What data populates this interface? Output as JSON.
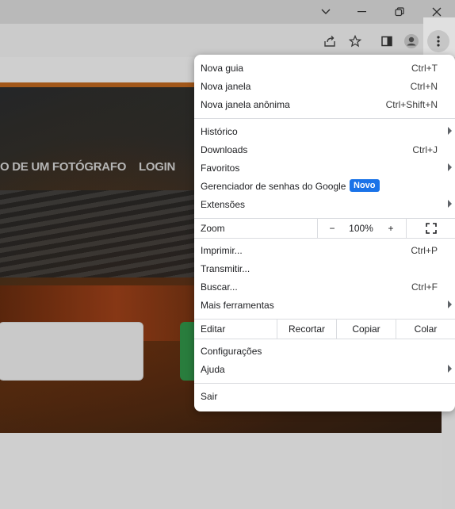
{
  "window": {
    "icons": [
      "chevron-down-icon",
      "minimize-icon",
      "restore-icon",
      "close-icon"
    ]
  },
  "toolbar": {
    "icons": [
      "share-icon",
      "star-icon",
      "side-panel-icon",
      "profile-icon",
      "kebab-menu-icon"
    ]
  },
  "page": {
    "nav_about": "O DE UM FOTÓGRAFO",
    "nav_login": "LOGIN"
  },
  "menu": {
    "new_tab": {
      "label": "Nova guia",
      "shortcut": "Ctrl+T"
    },
    "new_window": {
      "label": "Nova janela",
      "shortcut": "Ctrl+N"
    },
    "incognito": {
      "label": "Nova janela anônima",
      "shortcut": "Ctrl+Shift+N"
    },
    "history": {
      "label": "Histórico"
    },
    "downloads": {
      "label": "Downloads",
      "shortcut": "Ctrl+J"
    },
    "bookmarks": {
      "label": "Favoritos"
    },
    "passwords": {
      "label": "Gerenciador de senhas do Google",
      "badge": "Novo"
    },
    "extensions": {
      "label": "Extensões"
    },
    "zoom": {
      "label": "Zoom",
      "minus": "−",
      "value": "100%",
      "plus": "+"
    },
    "print": {
      "label": "Imprimir...",
      "shortcut": "Ctrl+P"
    },
    "cast": {
      "label": "Transmitir..."
    },
    "find": {
      "label": "Buscar...",
      "shortcut": "Ctrl+F"
    },
    "more_tools": {
      "label": "Mais ferramentas"
    },
    "edit": {
      "label": "Editar",
      "cut": "Recortar",
      "copy": "Copiar",
      "paste": "Colar"
    },
    "settings": {
      "label": "Configurações"
    },
    "help": {
      "label": "Ajuda"
    },
    "exit": {
      "label": "Sair"
    }
  },
  "colors": {
    "accent_badge": "#1a73e8",
    "orange_bar": "#b8631e",
    "green_button": "#2f8f46"
  }
}
